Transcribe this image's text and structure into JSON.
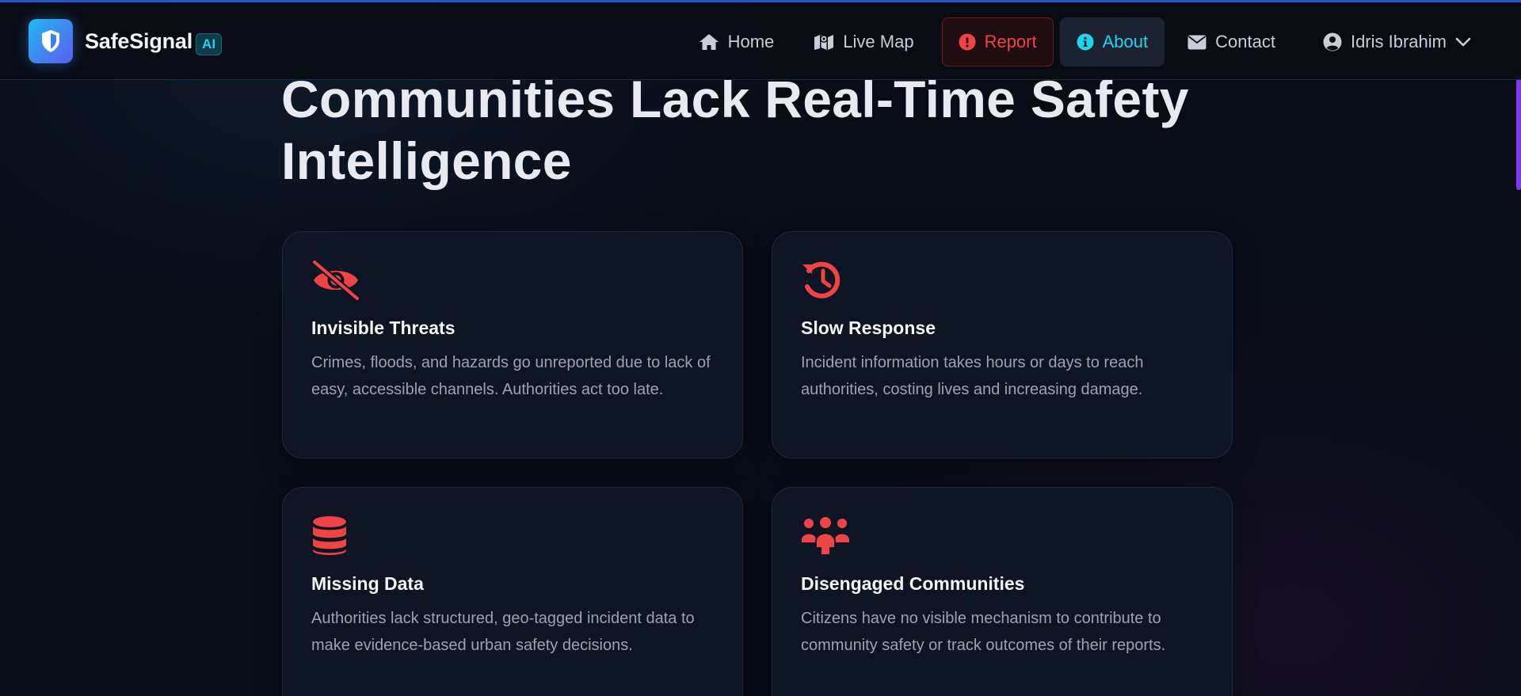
{
  "brand": {
    "name": "SafeSignal",
    "badge": "AI"
  },
  "nav": {
    "items": [
      {
        "label": "Home",
        "icon": "home-icon"
      },
      {
        "label": "Live Map",
        "icon": "map-icon"
      },
      {
        "label": "Report",
        "icon": "exclamation-circle-icon"
      },
      {
        "label": "About",
        "icon": "info-circle-icon"
      },
      {
        "label": "Contact",
        "icon": "envelope-icon"
      }
    ],
    "user": {
      "name": "Idris Ibrahim",
      "icon": "user-circle-icon"
    }
  },
  "hero": {
    "headline_line1": "Communities Lack Real-Time Safety",
    "headline_line2": "Intelligence"
  },
  "problems": [
    {
      "icon": "eye-slash-icon",
      "title": "Invisible Threats",
      "description": "Crimes, floods, and hazards go unreported due to lack of easy, accessible channels. Authorities act too late."
    },
    {
      "icon": "history-clock-icon",
      "title": "Slow Response",
      "description": "Incident information takes hours or days to reach authorities, costing lives and increasing damage."
    },
    {
      "icon": "database-icon",
      "title": "Missing Data",
      "description": "Authorities lack structured, geo-tagged incident data to make evidence-based urban safety decisions."
    },
    {
      "icon": "people-group-icon",
      "title": "Disengaged Communities",
      "description": "Citizens have no visible mechanism to contribute to community safety or track outcomes of their reports."
    }
  ],
  "colors": {
    "accent_red": "#ef4444",
    "accent_cyan": "#22d3ee",
    "background": "#080c16",
    "card": "#0d1424",
    "scroll_thumb": "#7c3aed"
  }
}
